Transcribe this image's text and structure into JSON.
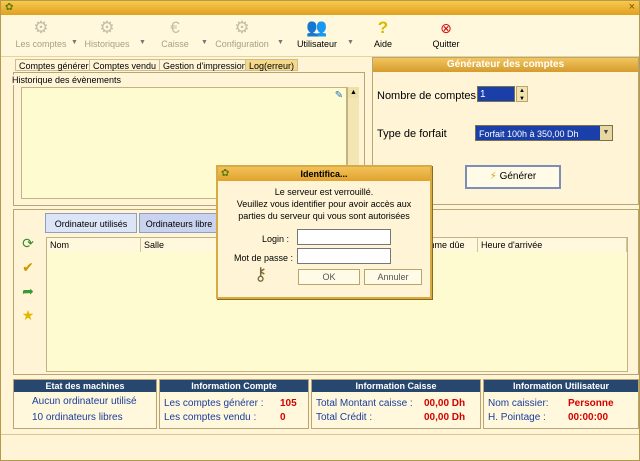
{
  "toolbar": {
    "items": [
      {
        "label": "Les comptes",
        "icon": "gear-icon"
      },
      {
        "label": "Historiques",
        "icon": "history-icon"
      },
      {
        "label": "Caisse",
        "icon": "euro-icon"
      },
      {
        "label": "Configuration",
        "icon": "config-icon"
      },
      {
        "label": "Utilisateur",
        "icon": "users-icon"
      },
      {
        "label": "Aide",
        "icon": "help-icon"
      },
      {
        "label": "Quitter",
        "icon": "close-icon"
      }
    ]
  },
  "top_tabs": [
    "Comptes générer",
    "Comptes vendu",
    "Gestion d'impression",
    "Log(erreur)"
  ],
  "history": {
    "label": "Historique des évènements"
  },
  "generator": {
    "title": "Générateur des comptes",
    "count_label": "Nombre de comptes",
    "count_value": "1",
    "forfait_label": "Type de forfait",
    "forfait_value": "Forfait 100h à 350,00 Dh",
    "button_label": "Générer"
  },
  "lower_tabs": [
    "Ordinateur utilisés",
    "Ordinateurs libre"
  ],
  "table": {
    "columns": [
      "Nom",
      "Salle",
      "mme dûe",
      "Heure d'arrivée"
    ]
  },
  "dialog": {
    "title": "Identifica...",
    "msg_line1": "Le serveur est verrouillé.",
    "msg_line2": "Veuillez vous identifier pour avoir accès aux",
    "msg_line3": "parties du serveur qui vous sont autorisées",
    "login_label": "Login :",
    "password_label": "Mot de passe :",
    "ok_label": "OK",
    "cancel_label": "Annuler"
  },
  "info": {
    "machines": {
      "title": "Etat des machines",
      "line1": "Aucun ordinateur utilisé",
      "line2": "10 ordinateurs libres"
    },
    "compte": {
      "title": "Information Compte",
      "label1": "Les comptes générer :",
      "value1": "105",
      "label2": "Les comptes vendu :",
      "value2": "0"
    },
    "caisse": {
      "title": "Information Caisse",
      "label1": "Total Montant caisse :",
      "value1": "00,00 Dh",
      "label2": "Total Crédit :",
      "value2": "00,00 Dh"
    },
    "utilisateur": {
      "title": "Information Utilisateur",
      "label1": "Nom caissier:",
      "value1": "Personne",
      "label2": "H. Pointage :",
      "value2": "00:00:00"
    }
  },
  "colors": {
    "accent": "#e0a022",
    "header": "#27476e",
    "value_red": "#d40000",
    "selection": "#1a3fa8"
  }
}
